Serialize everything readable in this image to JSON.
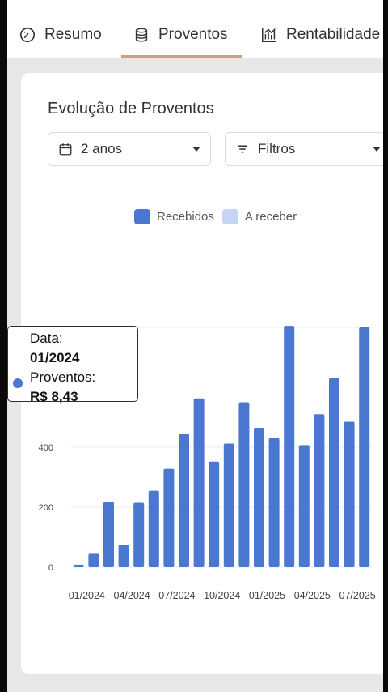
{
  "tabs": {
    "resumo": "Resumo",
    "proventos": "Proventos",
    "rentabilidade": "Rentabilidade",
    "active": "proventos"
  },
  "card": {
    "title": "Evolução de Proventos",
    "period_select": "2 anos",
    "filter_select": "Filtros"
  },
  "colors": {
    "received": "#4a78d1",
    "to_receive": "#c5d5f3",
    "tab_underline": "#c9a57a"
  },
  "tooltip": {
    "date_label": "Data:",
    "date_value": "01/2024",
    "amount_label": "Proventos:",
    "amount_value": "R$ 8,43"
  },
  "chart_data": {
    "type": "bar",
    "legend": [
      "Recebidos",
      "A receber"
    ],
    "legend_position": "top",
    "categories": [
      "01/2024",
      "02/2024",
      "03/2024",
      "04/2024",
      "05/2024",
      "06/2024",
      "07/2024",
      "08/2024",
      "09/2024",
      "10/2024",
      "11/2024",
      "12/2024",
      "01/2025",
      "02/2025",
      "03/2025",
      "04/2025",
      "05/2025",
      "06/2025",
      "07/2025",
      "08/2025"
    ],
    "x_tick_labels": [
      "01/2024",
      "04/2024",
      "07/2024",
      "10/2024",
      "01/2025",
      "04/2025",
      "07/2025"
    ],
    "series": [
      {
        "name": "Recebidos",
        "values": [
          8.43,
          45,
          218,
          75,
          215,
          255,
          328,
          445,
          563,
          352,
          412,
          550,
          465,
          430,
          805,
          407,
          510,
          630,
          485,
          800
        ]
      },
      {
        "name": "A receber",
        "values": [
          0,
          0,
          0,
          0,
          0,
          0,
          0,
          0,
          0,
          0,
          0,
          0,
          0,
          0,
          0,
          0,
          0,
          0,
          0,
          0
        ]
      }
    ],
    "y_ticks": [
      0,
      200,
      400
    ],
    "ylim": [
      0,
      800
    ],
    "grid": true
  }
}
